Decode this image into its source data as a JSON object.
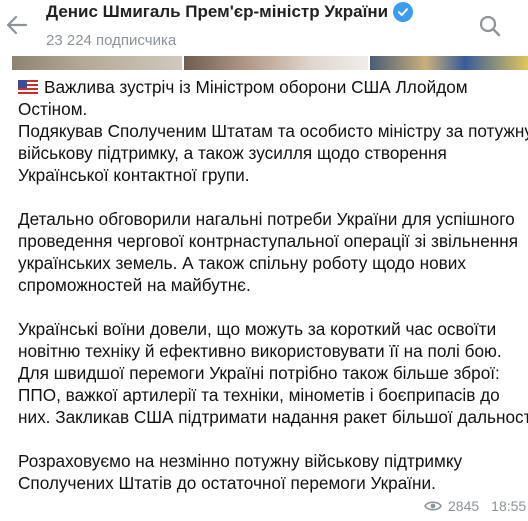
{
  "header": {
    "channel_title": "Денис Шмигаль Прем'єр-міністр України",
    "subscribers": "23 224 подписчика",
    "icons": {
      "back": "back-arrow-icon",
      "verified": "verified-badge-icon",
      "search": "search-icon"
    }
  },
  "post": {
    "flag_icon": "us-flag-icon",
    "paragraphs": [
      {
        "lines": [
          "Важлива зустріч із Міністром оборони США Ллойдом",
          "Остіном.",
          "Подякував Сполученим Штатам та особисто міністру за потужну",
          "військову підтримку, а також зусилля щодо створення",
          "Української контактної групи."
        ]
      },
      {
        "lines": [
          "Детально обговорили нагальні потреби України для успішного",
          "проведення чергової контрнаступальної операції зі звільнення",
          "українських земель. А також спільну роботу щодо нових",
          "спроможностей на майбутнє."
        ]
      },
      {
        "lines": [
          "Українські воїни довели, що можуть за короткий час освоїти",
          "новітню техніку й ефективно використовувати її на полі бою.",
          "Для швидшої перемоги Україні потрібно також більше зброї:",
          "ППО, важкої артилерії та техніки, мінометів і боєприпасів до",
          "них. Закликав США підтримати надання ракет більшої дальності."
        ]
      },
      {
        "lines": [
          "Розраховуємо на незмінно потужну військову підтримку",
          "Сполучених Штатів до остаточної перемоги України."
        ]
      }
    ],
    "views": "2845",
    "time": "18:55",
    "views_icon": "eye-icon"
  },
  "colors": {
    "verified": "#3a9df0",
    "muted_text": "#8d9399",
    "title_text": "#222222",
    "body_text": "#121212"
  }
}
